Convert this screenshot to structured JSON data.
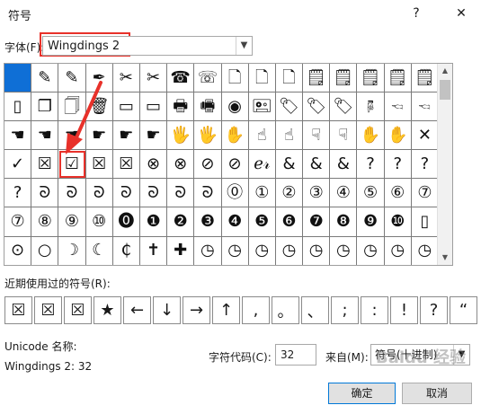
{
  "window": {
    "title": "符号",
    "help_glyph": "?",
    "close_glyph": "✕"
  },
  "font": {
    "label": "字体(F):",
    "value": "Wingdings 2",
    "dropdown_glyph": "▼"
  },
  "grid": {
    "rows": [
      [
        "",
        "✎",
        "✎",
        "✒",
        "✂",
        "✂",
        "☎",
        "☏",
        "🗋",
        "🗋",
        "🗋",
        "🗒",
        "🗒",
        "🗒",
        "🗒",
        "🗒"
      ],
      [
        "▯",
        "❐",
        "🗍",
        "🗑",
        "▭",
        "▭",
        "🖶",
        "🖷",
        "◉",
        "🖭",
        "🏷",
        "🏷",
        "🏷",
        "🖗",
        "🖘",
        "🖘"
      ],
      [
        "☚",
        "☚",
        "☚",
        "☛",
        "☛",
        "☛",
        "🖐",
        "🖐",
        "✋",
        "☝",
        "☝",
        "☟",
        "☟",
        "✋",
        "✋",
        "✕"
      ],
      [
        "✓",
        "☒",
        "☑",
        "☒",
        "☒",
        "⊗",
        "⊗",
        "⊘",
        "⊘",
        "ℯ𝓇",
        "&",
        "&",
        "&",
        "?",
        "?",
        "?"
      ],
      [
        "?",
        "ᘐ",
        "ᘐ",
        "ᘐ",
        "ᘐ",
        "ᘐ",
        "ᘐ",
        "ᘐ",
        "⓪",
        "①",
        "②",
        "③",
        "④",
        "⑤",
        "⑥",
        "⑦"
      ],
      [
        "⑦",
        "⑧",
        "⑨",
        "⑩",
        "⓿",
        "❶",
        "❷",
        "❸",
        "❹",
        "❺",
        "❻",
        "❼",
        "❽",
        "❾",
        "❿",
        "▯"
      ],
      [
        "⊙",
        "○",
        "☽",
        "☾",
        "₵",
        "✝",
        "✚",
        "◷",
        "◷",
        "◷",
        "◷",
        "◷",
        "◷",
        "◷",
        "◷",
        "◷"
      ]
    ],
    "scroll_up": "▲",
    "scroll_down": "▼"
  },
  "recent": {
    "label": "近期使用过的符号(R):",
    "symbols": [
      "☒",
      "☒",
      "☒",
      "★",
      "←",
      "↓",
      "→",
      "↑",
      ",",
      "。",
      "、",
      ";",
      ":",
      "!",
      "?",
      "“"
    ]
  },
  "unicode_name": {
    "label": "Unicode 名称:",
    "value": "Wingdings 2: 32"
  },
  "char_code": {
    "label": "字符代码(C):",
    "value": "32"
  },
  "from": {
    "label": "来自(M):",
    "value": "符号(十进制)",
    "dropdown_glyph": "▼"
  },
  "buttons": {
    "ok": "确定",
    "cancel": "取消"
  },
  "watermark": "Baidu 经验",
  "colors": {
    "selection": "#0f6fd6",
    "annotation": "#e8312a",
    "default_button_border": "#0078d7"
  }
}
